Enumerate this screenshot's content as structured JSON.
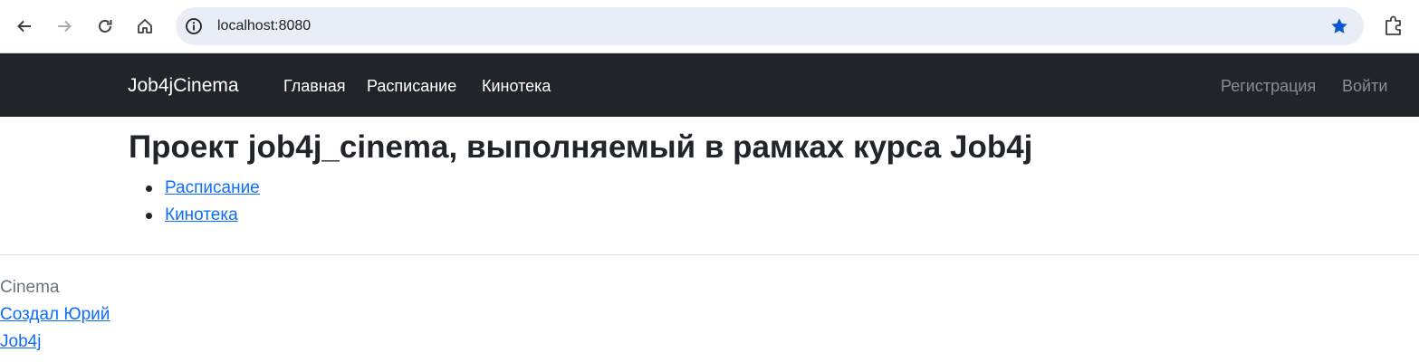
{
  "browser": {
    "url": "localhost:8080",
    "icons": {
      "back": "back-arrow-icon",
      "forward": "forward-arrow-icon",
      "reload": "reload-icon",
      "home": "home-icon",
      "site_info": "info-icon",
      "bookmark": "star-icon",
      "extensions": "puzzle-icon"
    },
    "accent_color": "#0b57d0"
  },
  "navbar": {
    "brand": "Job4jCinema",
    "links": [
      {
        "label": "Главная"
      },
      {
        "label": "Расписание"
      },
      {
        "label": "Кинотека"
      }
    ],
    "auth": {
      "register": "Регистрация",
      "login": "Войти"
    },
    "background": "#212529"
  },
  "main": {
    "title": "Проект job4j_cinema, выполняемый в рамках курса Job4j",
    "links": [
      {
        "label": "Расписание"
      },
      {
        "label": "Кинотека"
      }
    ],
    "link_color": "#0d6efd"
  },
  "footer": {
    "caption": "Cinema",
    "links": [
      {
        "label": "Создал Юрий"
      },
      {
        "label": "Job4j"
      }
    ]
  }
}
